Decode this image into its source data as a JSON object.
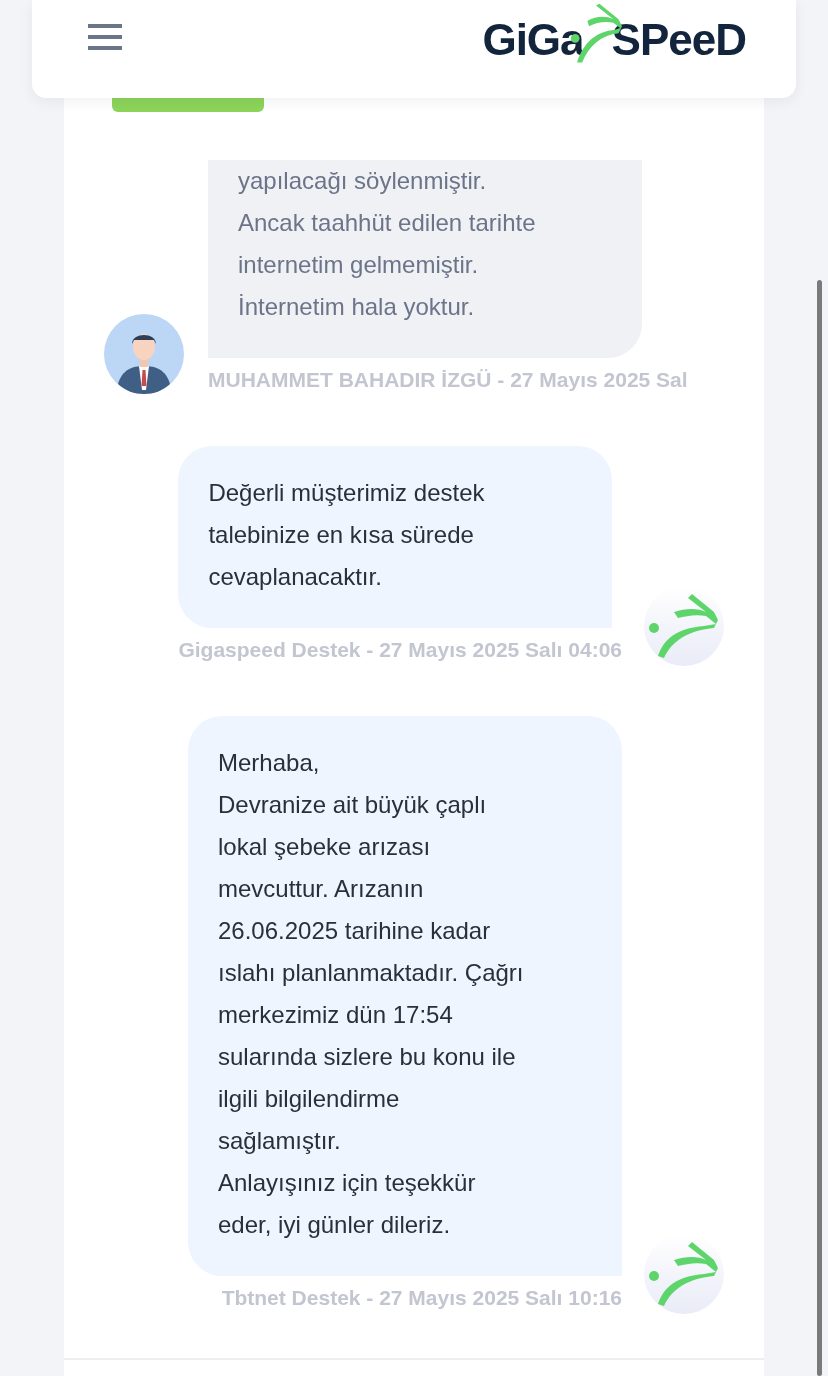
{
  "header": {
    "logo_text_left": "GiGa",
    "logo_text_right": "SPeeD"
  },
  "messages": [
    {
      "kind": "customer",
      "lines": [
        "yapılacağı söylenmiştir.",
        "Ancak taahhüt edilen tarihte",
        "internetim gelmemiştir.",
        "İnternetim hala yoktur."
      ],
      "meta": "MUHAMMET BAHADIR İZGÜ - 27 Mayıs 2025 Sal"
    },
    {
      "kind": "support",
      "lines": [
        "Değerli müşterimiz destek",
        "talebinize en kısa sürede",
        "cevaplanacaktır."
      ],
      "meta": "Gigaspeed Destek - 27 Mayıs 2025 Salı 04:06"
    },
    {
      "kind": "support",
      "lines": [
        "Merhaba,",
        "Devranize ait büyük çaplı",
        "lokal şebeke arızası",
        "mevcuttur. Arızanın",
        "26.06.2025 tarihine kadar",
        "ıslahı planlanmaktadır. Çağrı",
        "merkezimiz dün 17:54",
        "sularında sizlere bu konu ile",
        "ilgili bilgilendirme",
        "sağlamıştır.",
        "Anlayışınız için teşekkür",
        "eder, iyi günler dileriz."
      ],
      "meta": "Tbtnet Destek - 27 Mayıs 2025 Salı 10:16"
    }
  ]
}
